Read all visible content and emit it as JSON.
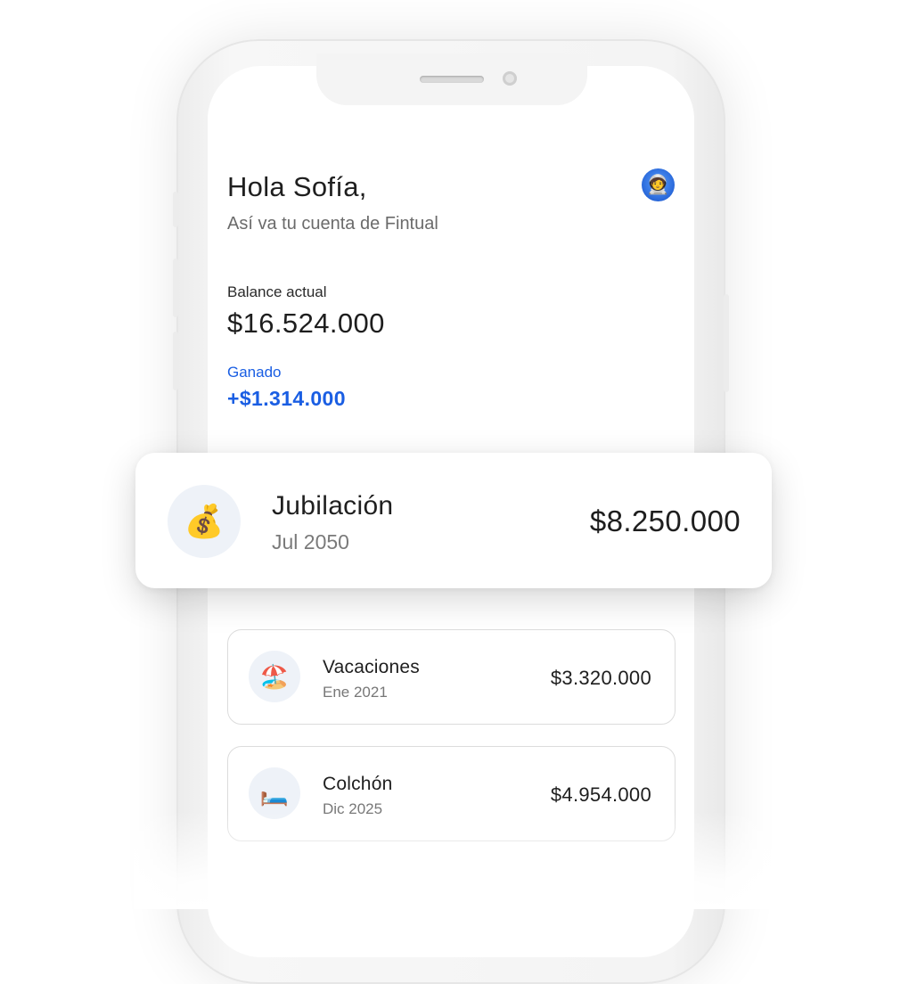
{
  "header": {
    "greeting": "Hola Sofía,",
    "subtitle": "Así va tu cuenta de Fintual",
    "avatar_icon": "🧑‍🚀"
  },
  "balance": {
    "label": "Balance actual",
    "value": "$16.524.000"
  },
  "earned": {
    "label": "Ganado",
    "value": "+$1.314.000",
    "color": "#1a5ee3"
  },
  "goals": [
    {
      "icon": "💰",
      "icon_name": "money-bag-icon",
      "name": "Jubilación",
      "date": "Jul 2050",
      "amount": "$8.250.000"
    },
    {
      "icon": "🏖️",
      "icon_name": "beach-umbrella-icon",
      "name": "Vacaciones",
      "date": "Ene 2021",
      "amount": "$3.320.000"
    },
    {
      "icon": "🛏️",
      "icon_name": "bed-icon",
      "name": "Colchón",
      "date": "Dic 2025",
      "amount": "$4.954.000"
    }
  ]
}
